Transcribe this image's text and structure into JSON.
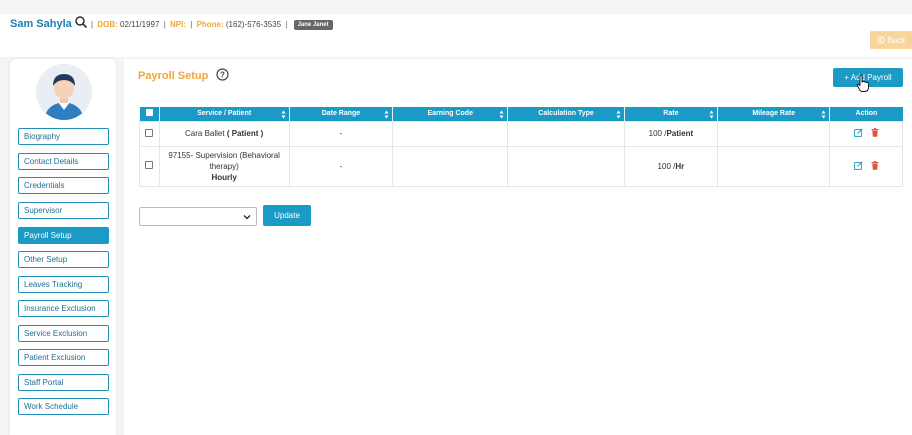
{
  "header": {
    "patient_name": "Sam Sahyla",
    "dob_label": "DOB:",
    "dob_value": "02/11/1997",
    "npi_label": "NPI:",
    "phone_label": "Phone:",
    "phone_value": "(162)-576-3535",
    "tag": "Jane Janet",
    "back_label": "Back"
  },
  "sidebar": {
    "items": [
      {
        "label": "Biography"
      },
      {
        "label": "Contact Details"
      },
      {
        "label": "Credentials"
      },
      {
        "label": "Supervisor"
      },
      {
        "label": "Payroll Setup"
      },
      {
        "label": "Other Setup"
      },
      {
        "label": "Leaves Tracking"
      },
      {
        "label": "Insurance Exclusion"
      },
      {
        "label": "Service Exclusion"
      },
      {
        "label": "Patient Exclusion"
      },
      {
        "label": "Staff Portal"
      },
      {
        "label": "Work Schedule"
      }
    ]
  },
  "main": {
    "title": "Payroll Setup",
    "add_button": "+ Add Payroll",
    "update_button": "Update"
  },
  "table": {
    "headers": [
      "Service / Patient",
      "Date Range",
      "Earning Code",
      "Calculation Type",
      "Rate",
      "Mileage Rate",
      "Action"
    ],
    "rows": [
      {
        "service": "Cara Ballet",
        "service_bold": "( Patient )",
        "date_range": "-",
        "rate": "100 /",
        "rate_bold": "Patient"
      },
      {
        "service": "97155- Supervision (Behavioral therapy)",
        "service_bold": "Hourly",
        "date_range": "-",
        "rate": "100 /",
        "rate_bold": "Hr"
      }
    ]
  },
  "colors": {
    "accent": "#1a9ac4",
    "title_orange": "#f0a53a",
    "delete_red": "#e0533d"
  }
}
